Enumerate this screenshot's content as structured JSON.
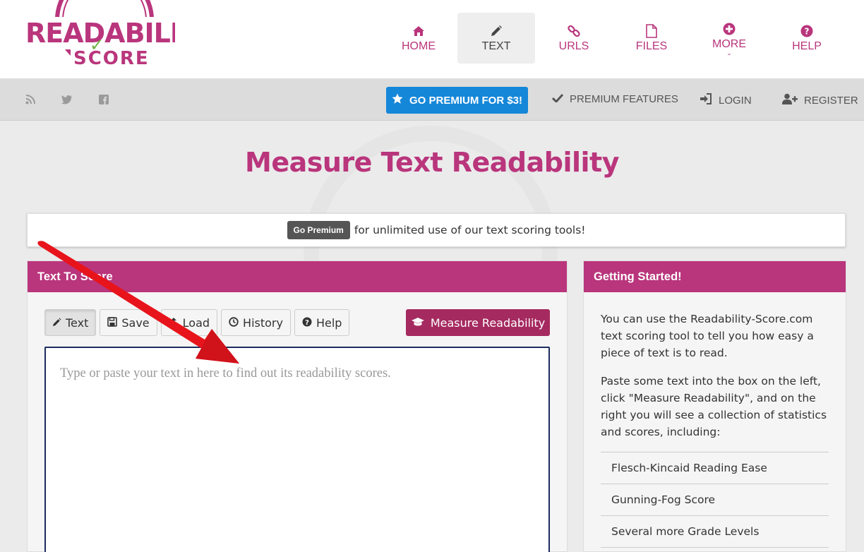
{
  "logo": {
    "line1": "READABILITY",
    "line2": "SCORE"
  },
  "nav": [
    {
      "label": "HOME",
      "icon": "home-icon"
    },
    {
      "label": "TEXT",
      "icon": "pencil-icon",
      "active": true
    },
    {
      "label": "URLS",
      "icon": "link-icon"
    },
    {
      "label": "FILES",
      "icon": "file-icon"
    },
    {
      "label": "MORE",
      "icon": "plus-circle-icon"
    },
    {
      "label": "HELP",
      "icon": "question-circle-icon"
    }
  ],
  "subbar": {
    "social": [
      "rss-icon",
      "twitter-icon",
      "facebook-icon"
    ],
    "premium_button": "GO PREMIUM FOR $3!",
    "premium_features": "PREMIUM FEATURES",
    "login": "LOGIN",
    "register": "REGISTER"
  },
  "page": {
    "title": "Measure Text Readability"
  },
  "promo": {
    "pill": "Go Premium",
    "text": "for unlimited use of our text scoring tools!"
  },
  "left_panel": {
    "title": "Text To Score",
    "tabs": [
      "Text",
      "Save",
      "Load",
      "History",
      "Help"
    ],
    "measure_button": "Measure Readability",
    "textarea_placeholder": "Type or paste your text in here to find out its readability scores."
  },
  "right_panel": {
    "title": "Getting Started!",
    "para1": "You can use the Readability-Score.com text scoring tool to tell you how easy a piece of text is to read.",
    "para2": "Paste some text into the box on the left, click \"Measure Readability\", and on the right you will see a collection of statistics and scores, including:",
    "features": [
      "Flesch-Kincaid Reading Ease",
      "Gunning-Fog Score",
      "Several more Grade Levels"
    ]
  },
  "colors": {
    "brand": "#b9357c",
    "premium_blue": "#1587d9",
    "measure_btn": "#a52a5f",
    "arrow": "#e8141b"
  }
}
